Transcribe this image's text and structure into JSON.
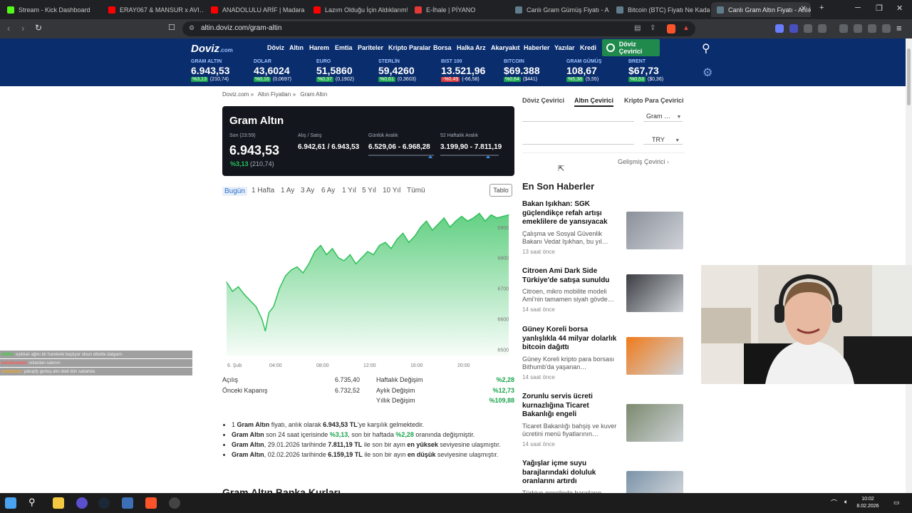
{
  "browser": {
    "tabs": [
      {
        "title": "Stream - Kick Dashboard",
        "color": "#53fc18"
      },
      {
        "title": "ERAY067 & MANSUR x AVI…",
        "color": "#ff0000"
      },
      {
        "title": "ANADOLULU ARİF | Madara Ol…",
        "color": "#ff0000"
      },
      {
        "title": "Lazım Olduğu İçin Aldıklarım! 1…",
        "color": "#ff0000"
      },
      {
        "title": "E-İhale | PİYANO",
        "color": "#e53935"
      },
      {
        "title": "Canlı Gram Gümüş Fiyatı - Anlı…",
        "color": "#607d8b"
      },
      {
        "title": "Bitcoin (BTC) Fiyatı Ne Kadar? …",
        "color": "#607d8b"
      },
      {
        "title": "Canlı Gram Altın Fiyatı - Anlık…",
        "color": "#607d8b"
      }
    ],
    "url": "altin.doviz.com/gram-altin"
  },
  "site": {
    "logo": "Doviz",
    "logo_suffix": ".com",
    "nav": [
      "Döviz",
      "Altın",
      "Harem",
      "Emtia",
      "Pariteler",
      "Kripto Paralar",
      "Borsa",
      "Halka Arz",
      "Akaryakıt",
      "Haberler",
      "Yazılar",
      "Kredi"
    ],
    "converter_button": "Döviz Çevirici",
    "tickers": [
      {
        "name": "GRAM ALTIN",
        "value": "6.943,53",
        "pct": "%3,13",
        "abs": "(210,74)",
        "dir": "up"
      },
      {
        "name": "DOLAR",
        "value": "43,6024",
        "pct": "%0,16",
        "abs": "(0,0697)",
        "dir": "up"
      },
      {
        "name": "EURO",
        "value": "51,5860",
        "pct": "%0,37",
        "abs": "(0,1902)",
        "dir": "up"
      },
      {
        "name": "STERLİN",
        "value": "59,4260",
        "pct": "%0,61",
        "abs": "(0,3603)",
        "dir": "up"
      },
      {
        "name": "BIST 100",
        "value": "13.521,96",
        "pct": "-%0,49",
        "abs": "(-66,58)",
        "dir": "down"
      },
      {
        "name": "BITCOIN",
        "value": "$69.388",
        "pct": "%0,64",
        "abs": "($441)",
        "dir": "up"
      },
      {
        "name": "GRAM GÜMÜŞ",
        "value": "108,67",
        "pct": "%5,38",
        "abs": "(5,55)",
        "dir": "up"
      },
      {
        "name": "BRENT",
        "value": "$67,73",
        "pct": "%0,53",
        "abs": "($0,36)",
        "dir": "up"
      }
    ]
  },
  "breadcrumb": [
    "Doviz.com »",
    "Altın Fiyatları »",
    "Gram Altın"
  ],
  "card": {
    "title": "Gram Altın",
    "last_label": "Son (23:59)",
    "last_value": "6.943,53",
    "change_pct": "%3,13",
    "change_abs": "(210,74)",
    "bidask_label": "Alış / Satış",
    "bidask_value": "6.942,61 / 6.943,53",
    "daily_label": "Günlük Aralık",
    "daily_value": "6.529,06 - 6.968,28",
    "daily_marker": 0.95,
    "weekly_label": "52 Haftalık Aralık",
    "weekly_value": "3.199,90 - 7.811,19",
    "weekly_marker": 0.82
  },
  "periods": [
    "Bugün",
    "1 Hafta",
    "1 Ay",
    "3 Ay",
    "6 Ay",
    "1 Yıl",
    "5 Yıl",
    "10 Yıl",
    "Tümü"
  ],
  "table_button": "Tablo",
  "chart_data": {
    "type": "area",
    "x_ticks": [
      "6. Şub",
      "04:00",
      "08:00",
      "12:00",
      "16:00",
      "20:00"
    ],
    "y_ticks": [
      6500,
      6600,
      6700,
      6800,
      6900
    ],
    "ylim": [
      6480,
      6960
    ],
    "color": "#2fc05a",
    "x": [
      0,
      0.5,
      1,
      1.5,
      2,
      2.5,
      3,
      3.3,
      3.6,
      4,
      4.5,
      5,
      5.5,
      6,
      6.5,
      7,
      7.5,
      8,
      8.5,
      9,
      9.5,
      10,
      10.5,
      11,
      11.5,
      12,
      12.5,
      13,
      13.5,
      14,
      14.5,
      15,
      15.5,
      16,
      16.5,
      17,
      17.5,
      18,
      18.5,
      19,
      19.5,
      20,
      20.5,
      21,
      21.5,
      22,
      22.5,
      23,
      23.5,
      24
    ],
    "values": [
      6720,
      6690,
      6705,
      6680,
      6660,
      6640,
      6600,
      6560,
      6620,
      6640,
      6700,
      6740,
      6760,
      6770,
      6750,
      6780,
      6820,
      6840,
      6810,
      6830,
      6800,
      6790,
      6810,
      6780,
      6800,
      6820,
      6810,
      6840,
      6850,
      6830,
      6860,
      6880,
      6850,
      6870,
      6900,
      6920,
      6890,
      6910,
      6930,
      6900,
      6920,
      6935,
      6920,
      6930,
      6945,
      6920,
      6940,
      6930,
      6935,
      6940
    ]
  },
  "stats_left": [
    {
      "label": "Açılış",
      "value": "6.735,40"
    },
    {
      "label": "Önceki Kapanış",
      "value": "6.732,52"
    }
  ],
  "stats_right": [
    {
      "label": "Haftalık Değişim",
      "value": "%2,28"
    },
    {
      "label": "Aylık Değişim",
      "value": "%12,73"
    },
    {
      "label": "Yıllık Değişim",
      "value": "%109,88"
    }
  ],
  "bullets": {
    "b1": {
      "p1": "1 ",
      "b1": "Gram Altın",
      "p2": " fiyatı, anlık olarak ",
      "b2": "6.943,53 TL",
      "p3": "'ye karşılık gelmektedir."
    },
    "b2": {
      "b1": "Gram Altın",
      "p1": " son 24 saat içerisinde ",
      "g1": "%3,13",
      "p2": ", son bir haftada ",
      "g2": "%2,28",
      "p3": " oranında değişmiştir."
    },
    "b3": {
      "b1": "Gram Altın",
      "p1": ", 29.01.2026 tarihinde ",
      "b2": "7.811,19 TL",
      "p2": " ile son bir ayın ",
      "b3": "en yüksek",
      "p3": " seviyesine ulaşmıştır."
    },
    "b4": {
      "b1": "Gram Altın",
      "p1": ", 02.02.2026 tarihinde ",
      "b2": "6.159,19 TL",
      "p2": " ile son bir ayın ",
      "b3": "en düşük",
      "p3": " seviyesine ulaşmıştır."
    }
  },
  "bank_heading": "Gram Altın Banka Kurları",
  "converter": {
    "tabs": [
      "Döviz Çevirici",
      "Altın Çevirici",
      "Kripto Para Çevirici"
    ],
    "select1": "Gram …",
    "select2": "TRY",
    "advanced": "Gelişmiş Çevirici"
  },
  "news_heading": "En Son Haberler",
  "news": [
    {
      "title": "Bakan Işıkhan: SGK güçlendikçe refah artışı emeklilere de yansıyacak",
      "desc": "Çalışma ve Sosyal Güvenlik Bakanı Vedat Işıkhan, bu yıl…",
      "time": "13 saat önce",
      "color": "#8a8f99"
    },
    {
      "title": "Citroen Ami Dark Side Türkiye'de satışa sunuldu",
      "desc": "Citroen, mikro mobilite modeli Ami'nin tamamen siyah gövde…",
      "time": "14 saat önce",
      "color": "#3b3d42"
    },
    {
      "title": "Güney Koreli borsa yanlışlıkla 44 milyar dolarlık bitcoin dağıttı",
      "desc": "Güney Koreli kripto para borsası Bithumb'da yaşanan…",
      "time": "14 saat önce",
      "color": "#f07a1a"
    },
    {
      "title": "Zorunlu servis ücreti kurnazlığına Ticaret Bakanlığı engeli",
      "desc": "Ticaret Bakanlığı bahşiş ve kuver ücretini menü fiyatlarının…",
      "time": "14 saat önce",
      "color": "#7c8a6e"
    },
    {
      "title": "Yağışlar içme suyu barajlarındaki doluluk oranlarını artırdı",
      "desc": "Türkiye genelinde barajların…",
      "time": "",
      "color": "#7a93a8"
    }
  ],
  "chat": [
    {
      "user": "zkiller",
      "text": "eşikkalı ağmı bir harekete başlıyor olsun elbette dalgamı",
      "color": "#3ad13a"
    },
    {
      "user": "kendineubet",
      "text": "onlardan sakının",
      "color": "#ff5b5b"
    },
    {
      "user": "oneducus",
      "text": "yakupfy gurtuş alın dedi dün sabahda",
      "color": "#f5a623"
    }
  ],
  "clock": {
    "time": "10:02",
    "date": "8.02.2026"
  }
}
